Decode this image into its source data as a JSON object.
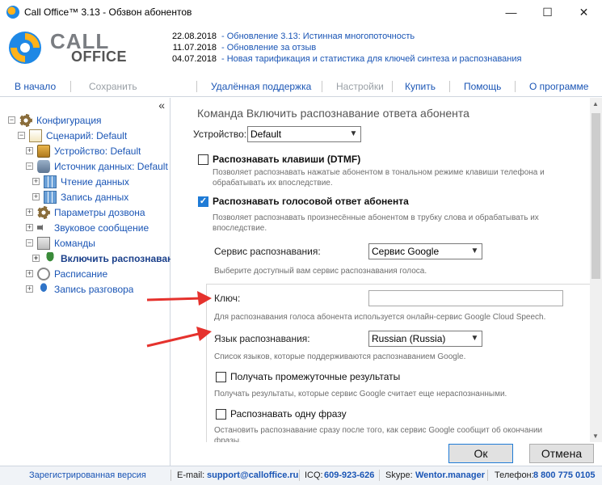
{
  "window": {
    "title": "Call Office™ 3.13 - Обзвон абонентов",
    "minimize": "—",
    "maximize": "☐",
    "close": "✕"
  },
  "logo": {
    "word1": "CALL",
    "word2": "OFFICE",
    "tm": "™"
  },
  "news": [
    {
      "date": "22.08.2018",
      "text": "- Обновление 3.13: Истинная многопоточность"
    },
    {
      "date": "11.07.2018",
      "text": "- Обновление за отзыв"
    },
    {
      "date": "04.07.2018",
      "text": "- Новая тарификация и статистика для ключей синтеза и распознавания"
    }
  ],
  "menu": {
    "home": "В начало",
    "save": "Сохранить",
    "remote": "Удалённая поддержка",
    "settings": "Настройки",
    "buy": "Купить",
    "help": "Помощь",
    "about": "О программе"
  },
  "sidebar": {
    "collapse": "«",
    "items": [
      {
        "label": "Конфигурация",
        "icon": "gear-icon"
      },
      {
        "label": "Сценарий: Default",
        "icon": "document-icon"
      },
      {
        "label": "Устройство: Default",
        "icon": "device-icon"
      },
      {
        "label": "Источник данных: Default",
        "icon": "database-icon"
      },
      {
        "label": "Чтение данных",
        "icon": "grid-icon"
      },
      {
        "label": "Запись данных",
        "icon": "grid-icon"
      },
      {
        "label": "Параметры дозвона",
        "icon": "gear-icon"
      },
      {
        "label": "Звуковое сообщение",
        "icon": "speaker-icon"
      },
      {
        "label": "Команды",
        "icon": "commands-icon"
      },
      {
        "label": "Включить распознаван",
        "icon": "microphone-icon"
      },
      {
        "label": "Расписание",
        "icon": "clock-icon"
      },
      {
        "label": "Запись разговора",
        "icon": "record-icon"
      }
    ]
  },
  "main": {
    "title": "Команда Включить распознавание ответа абонента",
    "device_label": "Устройство:",
    "device_value": "Default",
    "dtmf_label": "Распознавать клавиши (DTMF)",
    "dtmf_desc1": "Позволяет распознавать нажатые абонентом в тональном режиме клавиши телефона и",
    "dtmf_desc2": "обрабатывать их впоследствие.",
    "voice_label": "Распознавать голосовой ответ абонента",
    "voice_desc1": "Позволяет распознавать произнесённые абонентом в трубку слова и обрабатывать их",
    "voice_desc2": "впоследствие.",
    "service_label": "Сервис распознавания:",
    "service_value": "Сервис Google",
    "service_desc": "Выберите доступный вам сервис распознавания голоса.",
    "key_label": "Ключ:",
    "key_value": "",
    "key_desc": "Для распознавания голоса абонента используется онлайн-сервис Google Cloud Speech.",
    "lang_label": "Язык распознавания:",
    "lang_value": "Russian (Russia)",
    "lang_desc": "Список языков, которые поддерживаются распознаванием Google.",
    "interim_label": "Получать промежуточные результаты",
    "interim_desc": "Получать результаты, которые сервис Google считает еще нераспознанными.",
    "single_label": "Распознавать одну фразу",
    "single_desc1": "Остановить распознавание сразу после того, как сервис Google сообщит об окончании",
    "single_desc2": "фразы."
  },
  "buttons": {
    "ok": "Ок",
    "cancel": "Отмена"
  },
  "status": {
    "registered": "Зарегистрированная версия",
    "email_label": "E-mail:",
    "email": "support@calloffice.ru",
    "icq_label": "ICQ:",
    "icq": "609-923-626",
    "skype_label": "Skype:",
    "skype": "Wentor.manager",
    "phone_label": "Телефон:",
    "phone": "8 800 775 0105"
  },
  "colors": {
    "link": "#1a55b5",
    "accent": "#1f7bd6",
    "arrow": "#e5322d"
  }
}
